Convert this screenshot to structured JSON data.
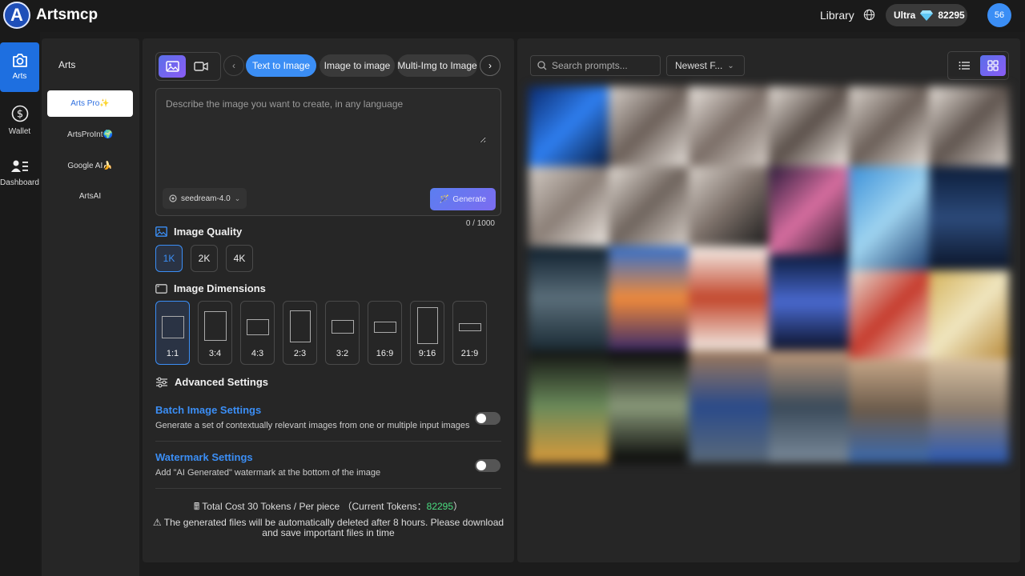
{
  "header": {
    "brand": "Artsmcp",
    "logo_letter": "A",
    "library_label": "Library",
    "plan_label": "Ultra",
    "token_count": "82295",
    "avatar_text": "56"
  },
  "sidebar": {
    "items": [
      {
        "label": "Arts",
        "icon": "camera-icon"
      },
      {
        "label": "Wallet",
        "icon": "dollar-icon"
      },
      {
        "label": "Dashboard",
        "icon": "user-list-icon"
      }
    ]
  },
  "subnav": {
    "title": "Arts",
    "items": [
      {
        "label": "Arts Pro✨"
      },
      {
        "label": "ArtsProInt🌍"
      },
      {
        "label": "Google AI🍌"
      },
      {
        "label": "ArtsAI"
      }
    ]
  },
  "generator": {
    "tabs": [
      {
        "label": "Text to Image"
      },
      {
        "label": "Image to image"
      },
      {
        "label": "Multi-Img to Image"
      }
    ],
    "prompt_placeholder": "Describe the image you want to create, in any language",
    "model": "seedream-4.0",
    "generate_label": "Generate",
    "char_count": "0 / 1000",
    "quality": {
      "title": "Image Quality",
      "options": [
        "1K",
        "2K",
        "4K"
      ],
      "selected": "1K"
    },
    "dimensions": {
      "title": "Image Dimensions",
      "options": [
        "1:1",
        "3:4",
        "4:3",
        "2:3",
        "3:2",
        "16:9",
        "9:16",
        "21:9"
      ],
      "selected": "1:1"
    },
    "advanced_title": "Advanced Settings",
    "batch": {
      "title": "Batch Image Settings",
      "desc": "Generate a set of contextually relevant images from one or multiple input images"
    },
    "watermark": {
      "title": "Watermark Settings",
      "desc": "Add \"AI Generated\" watermark at the bottom of the image"
    },
    "cost_text": "Total Cost 30 Tokens / Per piece （Current Tokens：",
    "cost_tokens": "82295",
    "cost_suffix": "）",
    "warning_line1": "⚠ The generated files will be automatically deleted after 8 hours. Please download",
    "warning_line2": "and save important files in time"
  },
  "gallery": {
    "search_placeholder": "Search prompts...",
    "sort_label": "Newest F..."
  },
  "colors": {
    "accent": "#3b8ef5",
    "token_green": "#4ade80",
    "panel_bg": "#262626"
  }
}
